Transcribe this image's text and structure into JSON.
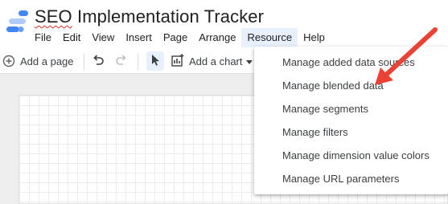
{
  "app": {
    "title_word_1": "SEO",
    "title_rest": " Implementation Tracker"
  },
  "menubar": {
    "items": [
      "File",
      "Edit",
      "View",
      "Insert",
      "Page",
      "Arrange",
      "Resource",
      "Help"
    ],
    "active": "Resource"
  },
  "toolbar": {
    "add_page_label": "Add a page",
    "add_chart_label": "Add a chart"
  },
  "resource_menu": {
    "items": [
      "Manage added data sources",
      "Manage blended data",
      "Manage segments",
      "Manage filters",
      "Manage dimension value colors",
      "Manage URL parameters"
    ],
    "highlighted_by_annotation": "Manage blended data"
  },
  "colors": {
    "menu_active_bg": "#e8f0fe",
    "annotation_arrow": "#ea4335",
    "logo_blue": "#4285f4",
    "logo_light_blue": "#aecbfa"
  },
  "icons": [
    "add-page-icon",
    "undo-icon",
    "redo-icon",
    "select-cursor-icon",
    "add-chart-icon",
    "chevron-down-icon",
    "text-box-icon"
  ]
}
